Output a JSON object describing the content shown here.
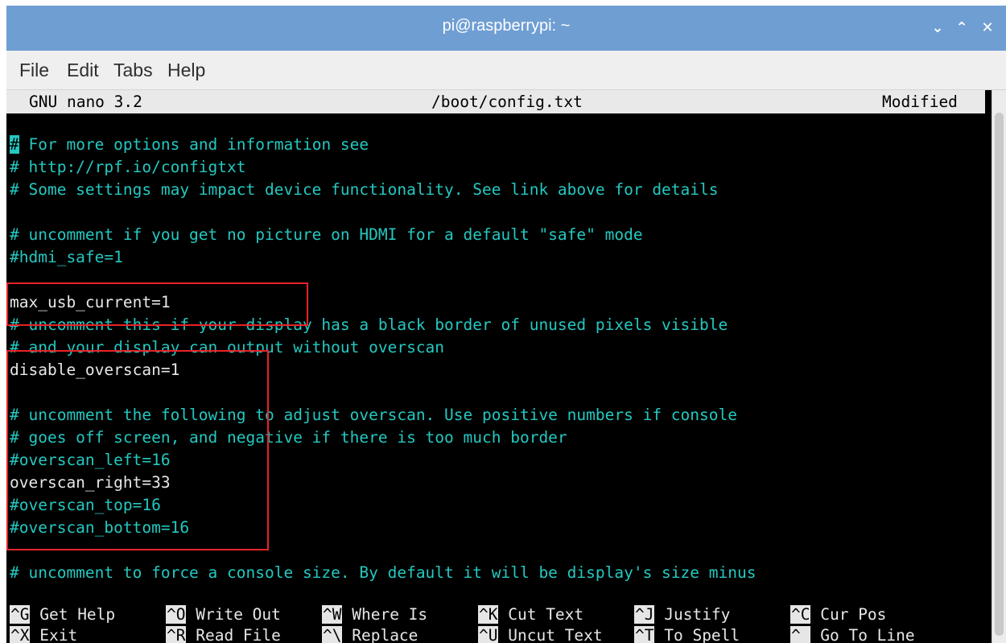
{
  "window": {
    "title": "pi@raspberrypi: ~",
    "controls": {
      "minimize": "⌄",
      "maximize": "⌃",
      "close": "✕"
    }
  },
  "menu": [
    "File",
    "Edit",
    "Tabs",
    "Help"
  ],
  "nano": {
    "version": "GNU nano 3.2",
    "filename": "/boot/config.txt",
    "state": "Modified"
  },
  "editor_lines": [
    "For more options and information see",
    "# http://rpf.io/configtxt",
    "# Some settings may impact device functionality. See link above for details",
    "",
    "# uncomment if you get no picture on HDMI for a default \"safe\" mode",
    "#hdmi_safe=1",
    "",
    "max_usb_current=1",
    "# uncomment this if your display has a black border of unused pixels visible",
    "# and your display can output without overscan",
    "disable_overscan=1",
    "",
    "# uncomment the following to adjust overscan. Use positive numbers if console",
    "# goes off screen, and negative if there is too much border",
    "#overscan_left=16",
    "overscan_right=33",
    "#overscan_top=16",
    "#overscan_bottom=16",
    "",
    "# uncomment to force a console size. By default it will be display's size minus"
  ],
  "cursor_char": "#",
  "shortcuts": [
    {
      "key": "^G",
      "label": "Get Help"
    },
    {
      "key": "^O",
      "label": "Write Out"
    },
    {
      "key": "^W",
      "label": "Where Is"
    },
    {
      "key": "^K",
      "label": "Cut Text"
    },
    {
      "key": "^J",
      "label": "Justify"
    },
    {
      "key": "^C",
      "label": "Cur Pos"
    },
    {
      "key": "^X",
      "label": "Exit"
    },
    {
      "key": "^R",
      "label": "Read File"
    },
    {
      "key": "^\\",
      "label": "Replace"
    },
    {
      "key": "^U",
      "label": "Uncut Text"
    },
    {
      "key": "^T",
      "label": "To Spell"
    },
    {
      "key": "^_",
      "label": "Go To Line"
    }
  ],
  "colors": {
    "titlebar": "#6f9ed3",
    "comment": "#24c8c0",
    "text": "#e7e7e7",
    "highlight_box": "#e8232a"
  }
}
